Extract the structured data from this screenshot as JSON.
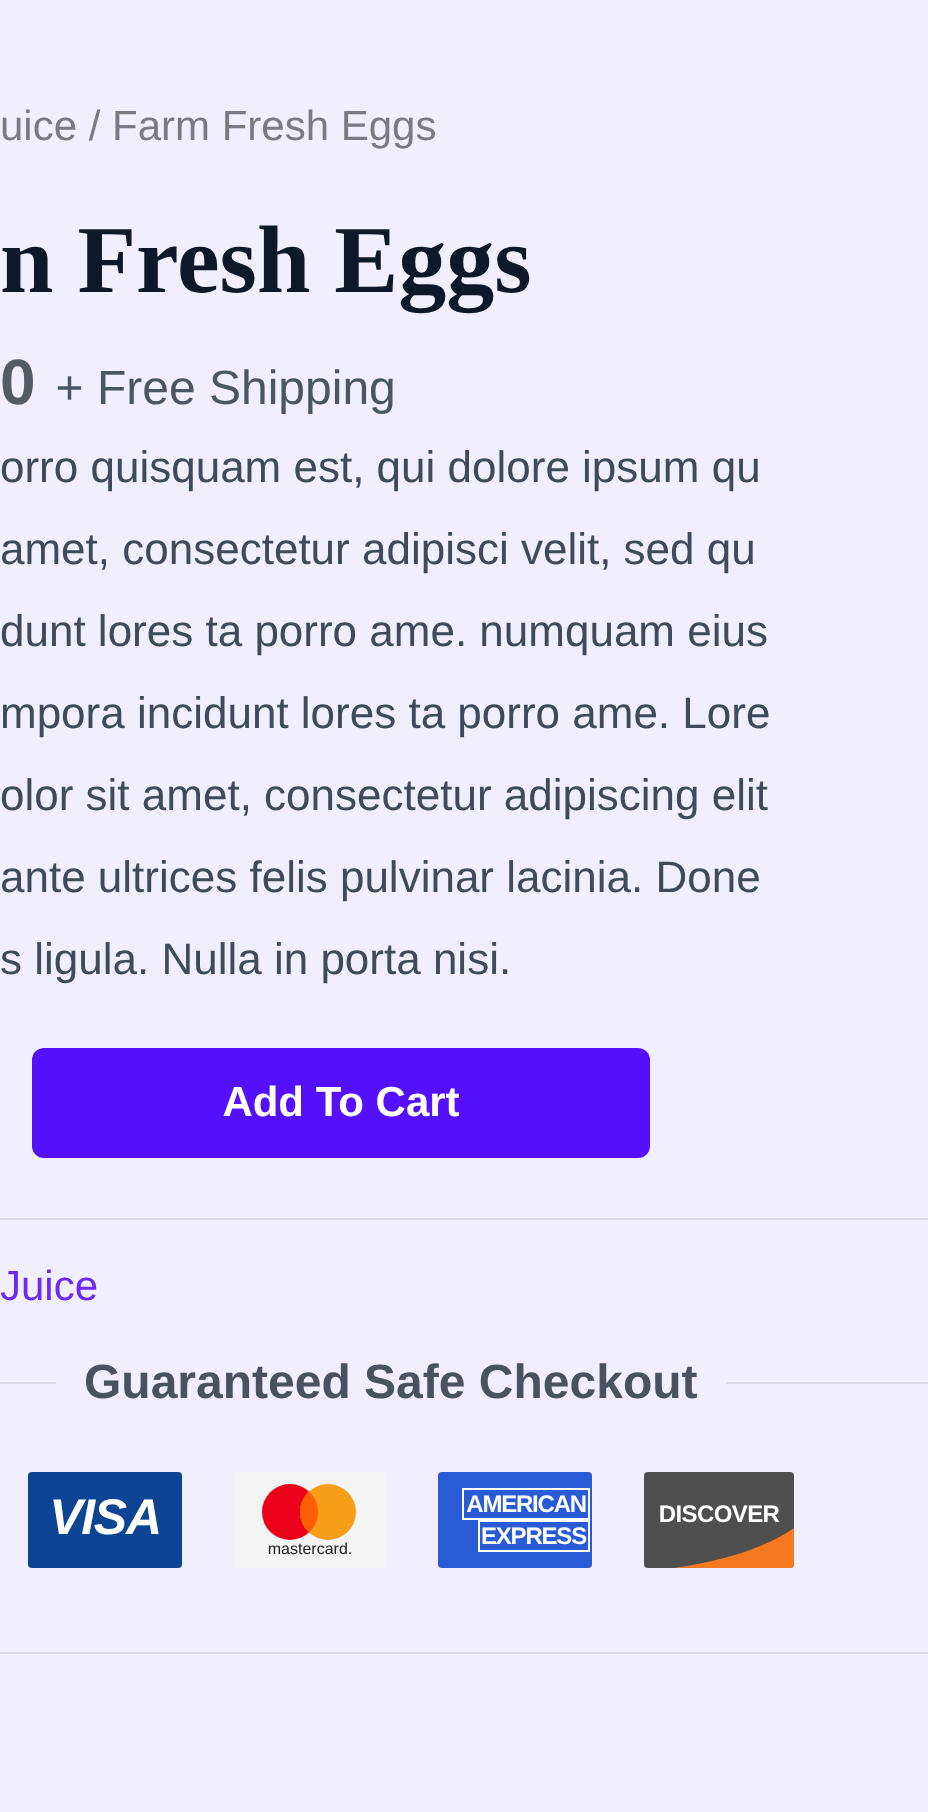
{
  "breadcrumb": "uice / Farm Fresh Eggs",
  "title": "n Fresh Eggs",
  "price": "0",
  "shipping": "+ Free Shipping",
  "description_lines": [
    "orro quisquam est, qui dolore ipsum qu",
    "amet, consectetur adipisci velit, sed qu",
    "dunt lores ta porro ame. numquam eius",
    "mpora incidunt lores ta porro ame. Lore",
    "olor sit amet, consectetur adipiscing elit",
    "ante ultrices felis pulvinar lacinia. Done",
    "s ligula. Nulla in porta nisi."
  ],
  "add_to_cart_button": "Add To Cart",
  "category_link": "Juice",
  "checkout_title": "Guaranteed Safe Checkout",
  "payment_cards": [
    {
      "kind": "visa",
      "lines": [
        "VISA"
      ]
    },
    {
      "kind": "mastercard",
      "lines": [
        "mastercard."
      ]
    },
    {
      "kind": "amex",
      "lines": [
        "AMERICAN",
        "EXPRESS"
      ]
    },
    {
      "kind": "discover",
      "lines": [
        "DISCOVER"
      ]
    }
  ]
}
